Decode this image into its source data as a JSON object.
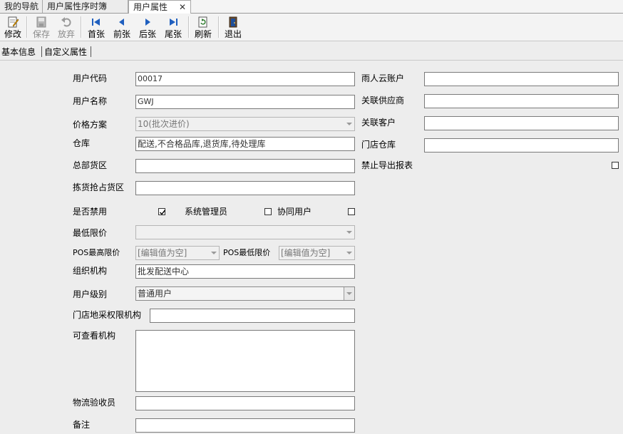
{
  "doc_tabs": [
    "我的导航",
    "用户属性序时簿",
    "用户属性"
  ],
  "toolbar": {
    "edit": "修改",
    "save": "保存",
    "discard": "放弃",
    "first": "首张",
    "prev": "前张",
    "next": "后张",
    "last": "尾张",
    "refresh": "刷新",
    "exit": "退出"
  },
  "page_tabs": [
    "基本信息",
    "自定义属性"
  ],
  "form": {
    "user_code": {
      "label": "用户代码",
      "value": "00017"
    },
    "user_name": {
      "label": "用户名称",
      "value": "GWJ"
    },
    "price_plan": {
      "label": "价格方案",
      "value": "10(批次进价)"
    },
    "warehouse": {
      "label": "仓库",
      "value": "配送,不合格品库,退货库,待处理库"
    },
    "hq_area": {
      "label": "总部货区",
      "value": ""
    },
    "pick_area": {
      "label": "拣货抢占货区",
      "value": ""
    },
    "disabled": {
      "label": "是否禁用",
      "checked": true
    },
    "sys_admin": {
      "label": "系统管理员",
      "checked": false
    },
    "collab_user": {
      "label": "协同用户",
      "checked": false
    },
    "min_price": {
      "label": "最低限价",
      "value": ""
    },
    "pos_max": {
      "label": "POS最高限价",
      "value": "[编辑值为空]"
    },
    "pos_min": {
      "label": "POS最低限价",
      "value": "[编辑值为空]"
    },
    "org": {
      "label": "组织机构",
      "value": "批发配送中心"
    },
    "user_level": {
      "label": "用户级别",
      "value": "普通用户"
    },
    "store_purchase_org": {
      "label": "门店地采权限机构",
      "value": ""
    },
    "viewable_org": {
      "label": "可查看机构",
      "value": ""
    },
    "logistics_checker": {
      "label": "物流验收员",
      "value": ""
    },
    "remark": {
      "label": "备注",
      "value": ""
    },
    "yuren_account": {
      "label": "雨人云账户",
      "value": ""
    },
    "linked_supplier": {
      "label": "关联供应商",
      "value": ""
    },
    "linked_customer": {
      "label": "关联客户",
      "value": ""
    },
    "store_warehouse": {
      "label": "门店仓库",
      "value": ""
    },
    "no_export": {
      "label": "禁止导出报表",
      "checked": false
    }
  }
}
